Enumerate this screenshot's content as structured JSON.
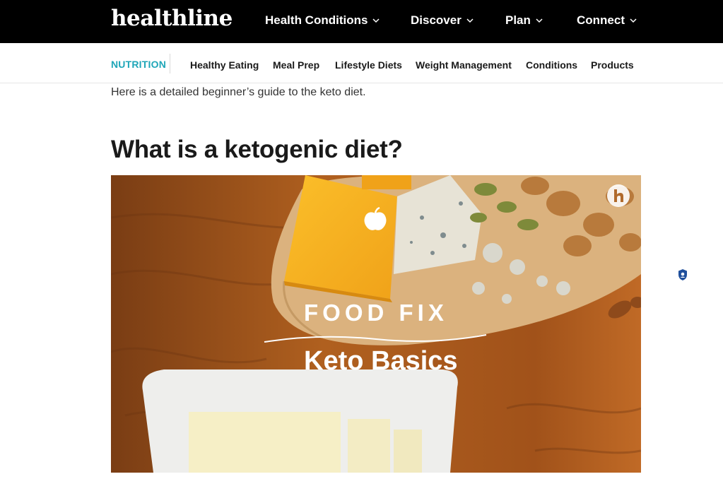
{
  "header": {
    "logo": "healthline",
    "nav": [
      {
        "label": "Health Conditions"
      },
      {
        "label": "Discover"
      },
      {
        "label": "Plan"
      },
      {
        "label": "Connect"
      }
    ]
  },
  "subnav": {
    "category": "NUTRITION",
    "items": [
      {
        "label": "Healthy Eating"
      },
      {
        "label": "Meal Prep"
      },
      {
        "label": "Lifestyle Diets"
      },
      {
        "label": "Weight Management"
      },
      {
        "label": "Conditions"
      },
      {
        "label": "Products"
      }
    ]
  },
  "article": {
    "intro": "Here is a detailed beginner’s guide to the keto diet.",
    "heading": "What is a ketogenic diet?",
    "video": {
      "series": "FOOD FIX",
      "title": "Keto Basics",
      "corner_icon": "healthline-h-icon",
      "brand_icon": "apple-icon"
    }
  },
  "side": {
    "badge_icon": "shield-badge-icon"
  },
  "colors": {
    "top_bar": "#000000",
    "accent": "#1fa6b8",
    "text": "#1a1a1a"
  }
}
